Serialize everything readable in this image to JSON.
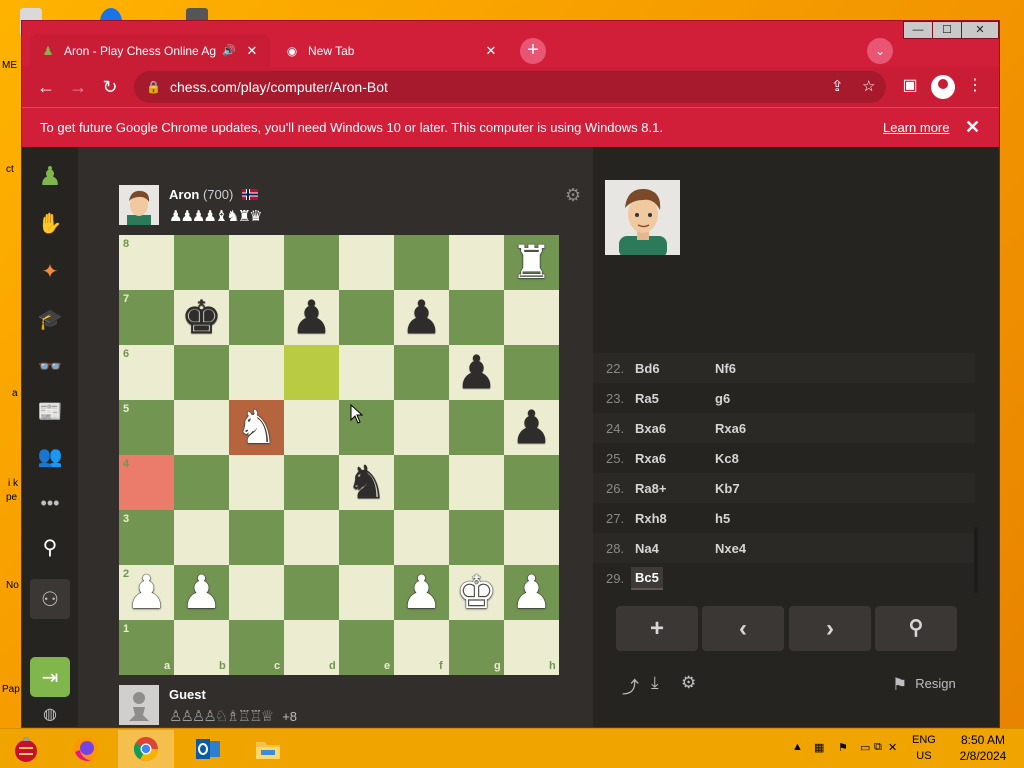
{
  "desktop": {
    "labels": [
      "ME",
      "ct",
      "a",
      "i k",
      "pe",
      "No",
      "Pap"
    ]
  },
  "browser": {
    "tabs": [
      {
        "title": "Aron - Play Chess Online Ag",
        "active": true,
        "icon": "chess-pawn-favicon"
      },
      {
        "title": "New Tab",
        "active": false,
        "icon": "chrome-newtab-favicon"
      }
    ],
    "window_controls": {
      "minimize": "—",
      "maximize": "☐",
      "close": "✕"
    },
    "url": "chess.com/play/computer/Aron-Bot",
    "infobar": {
      "message": "To get future Google Chrome updates, you'll need Windows 10 or later. This computer is using Windows 8.1.",
      "link": "Learn more"
    },
    "accent": "#d11f3a"
  },
  "chess": {
    "opponent": {
      "name": "Aron",
      "rating": "(700)",
      "captured": "♟♟♟♟♝♞♜♛"
    },
    "user": {
      "name": "Guest",
      "captured": "♙♙♙♙♘♗♖♖♕",
      "advantage": "+8"
    },
    "board": {
      "ranks": [
        "8",
        "7",
        "6",
        "5",
        "4",
        "3",
        "2",
        "1"
      ],
      "files": [
        "a",
        "b",
        "c",
        "d",
        "e",
        "f",
        "g",
        "h"
      ],
      "light_color": "#ebecd0",
      "dark_color": "#739552",
      "highlights": [
        {
          "square": "d6",
          "kind": "last-move"
        },
        {
          "square": "a4",
          "kind": "red"
        },
        {
          "square": "c5",
          "kind": "ochre"
        }
      ],
      "pieces": [
        {
          "square": "h8",
          "glyph": "♜",
          "color": "white",
          "name": "white-rook"
        },
        {
          "square": "b7",
          "glyph": "♚",
          "color": "black",
          "name": "black-king"
        },
        {
          "square": "d7",
          "glyph": "♟",
          "color": "black",
          "name": "black-pawn"
        },
        {
          "square": "f7",
          "glyph": "♟",
          "color": "black",
          "name": "black-pawn"
        },
        {
          "square": "g6",
          "glyph": "♟",
          "color": "black",
          "name": "black-pawn"
        },
        {
          "square": "c5",
          "glyph": "♞",
          "color": "white",
          "name": "white-knight"
        },
        {
          "square": "h5",
          "glyph": "♟",
          "color": "black",
          "name": "black-pawn"
        },
        {
          "square": "e4",
          "glyph": "♞",
          "color": "black",
          "name": "black-knight"
        },
        {
          "square": "a2",
          "glyph": "♟",
          "color": "white",
          "name": "white-pawn"
        },
        {
          "square": "b2",
          "glyph": "♟",
          "color": "white",
          "name": "white-pawn"
        },
        {
          "square": "f2",
          "glyph": "♟",
          "color": "white",
          "name": "white-pawn"
        },
        {
          "square": "g2",
          "glyph": "♚",
          "color": "white",
          "name": "white-king"
        },
        {
          "square": "h2",
          "glyph": "♟",
          "color": "white",
          "name": "white-pawn"
        }
      ]
    },
    "moves": [
      {
        "num": "22.",
        "white": "Bd6",
        "black": "Nf6"
      },
      {
        "num": "23.",
        "white": "Ra5",
        "black": "g6"
      },
      {
        "num": "24.",
        "white": "Bxa6",
        "black": "Rxa6"
      },
      {
        "num": "25.",
        "white": "Rxa6",
        "black": "Kc8"
      },
      {
        "num": "26.",
        "white": "Ra8+",
        "black": "Kb7"
      },
      {
        "num": "27.",
        "white": "Rxh8",
        "black": "h5"
      },
      {
        "num": "28.",
        "white": "Na4",
        "black": "Nxe4"
      },
      {
        "num": "29.",
        "white": "Bc5",
        "black": ""
      }
    ],
    "current_move": "Bc5",
    "controls": {
      "new": "+",
      "back": "‹",
      "forward": "›",
      "analyze": "⚲"
    },
    "resign": "Resign"
  },
  "taskbar": {
    "language": "ENG",
    "region": "US",
    "time": "8:50 AM",
    "date": "2/8/2024"
  }
}
